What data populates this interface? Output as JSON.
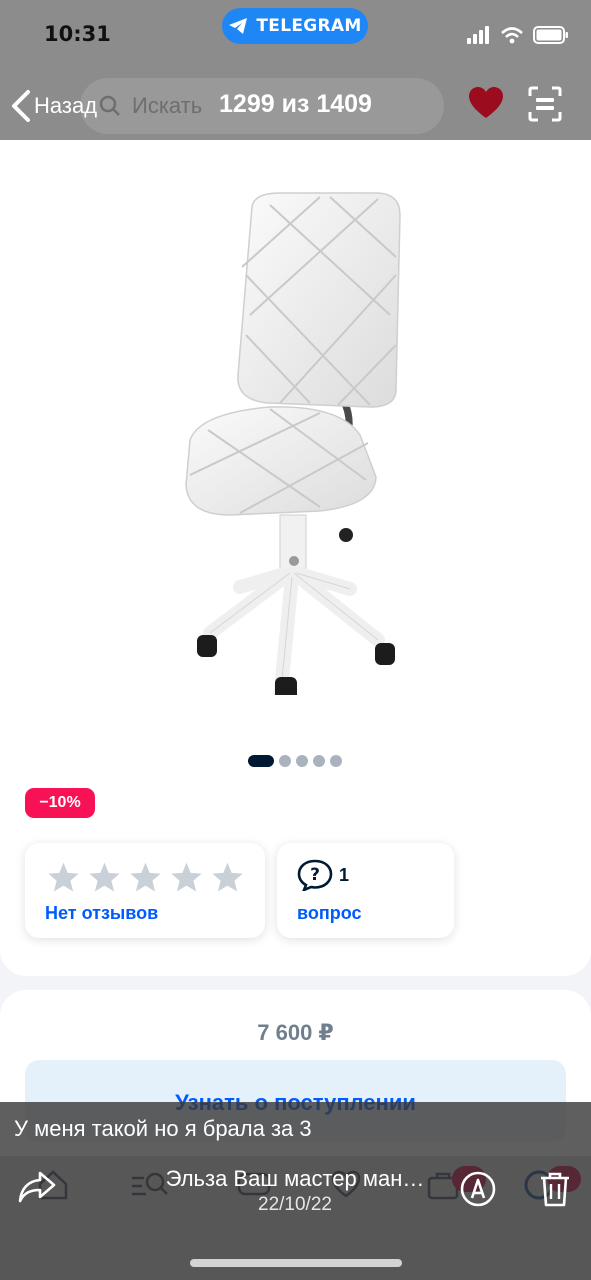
{
  "status_bar": {
    "time": "10:31",
    "app_pill": "TELEGRAM",
    "icons": [
      "signal-icon",
      "wifi-icon",
      "battery-icon"
    ]
  },
  "nav": {
    "back_label": "Назад",
    "counter": "1299 из 1409",
    "search_placeholder": "Искать",
    "favorite_color": "#9b0c1e"
  },
  "product": {
    "image": "white-office-chair",
    "gallery_pages": 5,
    "gallery_active": 1,
    "discount": "−10%",
    "reviews": {
      "rating_stars": 5,
      "rating_filled": 0,
      "link": "Нет отзывов"
    },
    "questions": {
      "count": "1",
      "link": "вопрос"
    },
    "price": "7 600 ₽",
    "notify_button": "Узнать о поступлении"
  },
  "viewer": {
    "caption": "У меня такой но я брала за 3",
    "sender": "Эльза Ваш мастер ман…",
    "date": "22/10/22"
  },
  "colors": {
    "accent_blue": "#005bff",
    "badge_pink": "#f91155",
    "text_dark": "#001a34",
    "telegram_blue": "#1f87f5"
  }
}
